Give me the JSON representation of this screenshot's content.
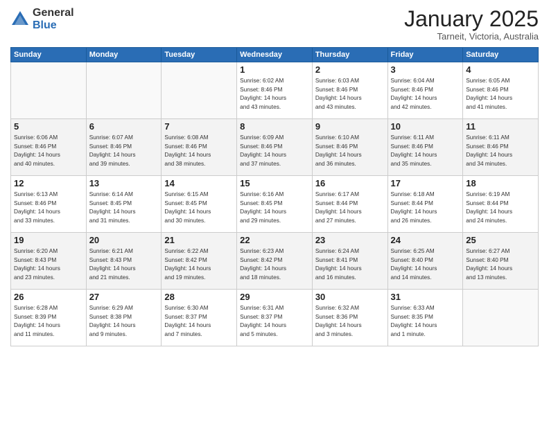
{
  "logo": {
    "general": "General",
    "blue": "Blue"
  },
  "header": {
    "month": "January 2025",
    "location": "Tarneit, Victoria, Australia"
  },
  "weekdays": [
    "Sunday",
    "Monday",
    "Tuesday",
    "Wednesday",
    "Thursday",
    "Friday",
    "Saturday"
  ],
  "weeks": [
    [
      {
        "day": "",
        "info": ""
      },
      {
        "day": "",
        "info": ""
      },
      {
        "day": "",
        "info": ""
      },
      {
        "day": "1",
        "info": "Sunrise: 6:02 AM\nSunset: 8:46 PM\nDaylight: 14 hours\nand 43 minutes."
      },
      {
        "day": "2",
        "info": "Sunrise: 6:03 AM\nSunset: 8:46 PM\nDaylight: 14 hours\nand 43 minutes."
      },
      {
        "day": "3",
        "info": "Sunrise: 6:04 AM\nSunset: 8:46 PM\nDaylight: 14 hours\nand 42 minutes."
      },
      {
        "day": "4",
        "info": "Sunrise: 6:05 AM\nSunset: 8:46 PM\nDaylight: 14 hours\nand 41 minutes."
      }
    ],
    [
      {
        "day": "5",
        "info": "Sunrise: 6:06 AM\nSunset: 8:46 PM\nDaylight: 14 hours\nand 40 minutes."
      },
      {
        "day": "6",
        "info": "Sunrise: 6:07 AM\nSunset: 8:46 PM\nDaylight: 14 hours\nand 39 minutes."
      },
      {
        "day": "7",
        "info": "Sunrise: 6:08 AM\nSunset: 8:46 PM\nDaylight: 14 hours\nand 38 minutes."
      },
      {
        "day": "8",
        "info": "Sunrise: 6:09 AM\nSunset: 8:46 PM\nDaylight: 14 hours\nand 37 minutes."
      },
      {
        "day": "9",
        "info": "Sunrise: 6:10 AM\nSunset: 8:46 PM\nDaylight: 14 hours\nand 36 minutes."
      },
      {
        "day": "10",
        "info": "Sunrise: 6:11 AM\nSunset: 8:46 PM\nDaylight: 14 hours\nand 35 minutes."
      },
      {
        "day": "11",
        "info": "Sunrise: 6:11 AM\nSunset: 8:46 PM\nDaylight: 14 hours\nand 34 minutes."
      }
    ],
    [
      {
        "day": "12",
        "info": "Sunrise: 6:13 AM\nSunset: 8:46 PM\nDaylight: 14 hours\nand 33 minutes."
      },
      {
        "day": "13",
        "info": "Sunrise: 6:14 AM\nSunset: 8:45 PM\nDaylight: 14 hours\nand 31 minutes."
      },
      {
        "day": "14",
        "info": "Sunrise: 6:15 AM\nSunset: 8:45 PM\nDaylight: 14 hours\nand 30 minutes."
      },
      {
        "day": "15",
        "info": "Sunrise: 6:16 AM\nSunset: 8:45 PM\nDaylight: 14 hours\nand 29 minutes."
      },
      {
        "day": "16",
        "info": "Sunrise: 6:17 AM\nSunset: 8:44 PM\nDaylight: 14 hours\nand 27 minutes."
      },
      {
        "day": "17",
        "info": "Sunrise: 6:18 AM\nSunset: 8:44 PM\nDaylight: 14 hours\nand 26 minutes."
      },
      {
        "day": "18",
        "info": "Sunrise: 6:19 AM\nSunset: 8:44 PM\nDaylight: 14 hours\nand 24 minutes."
      }
    ],
    [
      {
        "day": "19",
        "info": "Sunrise: 6:20 AM\nSunset: 8:43 PM\nDaylight: 14 hours\nand 23 minutes."
      },
      {
        "day": "20",
        "info": "Sunrise: 6:21 AM\nSunset: 8:43 PM\nDaylight: 14 hours\nand 21 minutes."
      },
      {
        "day": "21",
        "info": "Sunrise: 6:22 AM\nSunset: 8:42 PM\nDaylight: 14 hours\nand 19 minutes."
      },
      {
        "day": "22",
        "info": "Sunrise: 6:23 AM\nSunset: 8:42 PM\nDaylight: 14 hours\nand 18 minutes."
      },
      {
        "day": "23",
        "info": "Sunrise: 6:24 AM\nSunset: 8:41 PM\nDaylight: 14 hours\nand 16 minutes."
      },
      {
        "day": "24",
        "info": "Sunrise: 6:25 AM\nSunset: 8:40 PM\nDaylight: 14 hours\nand 14 minutes."
      },
      {
        "day": "25",
        "info": "Sunrise: 6:27 AM\nSunset: 8:40 PM\nDaylight: 14 hours\nand 13 minutes."
      }
    ],
    [
      {
        "day": "26",
        "info": "Sunrise: 6:28 AM\nSunset: 8:39 PM\nDaylight: 14 hours\nand 11 minutes."
      },
      {
        "day": "27",
        "info": "Sunrise: 6:29 AM\nSunset: 8:38 PM\nDaylight: 14 hours\nand 9 minutes."
      },
      {
        "day": "28",
        "info": "Sunrise: 6:30 AM\nSunset: 8:37 PM\nDaylight: 14 hours\nand 7 minutes."
      },
      {
        "day": "29",
        "info": "Sunrise: 6:31 AM\nSunset: 8:37 PM\nDaylight: 14 hours\nand 5 minutes."
      },
      {
        "day": "30",
        "info": "Sunrise: 6:32 AM\nSunset: 8:36 PM\nDaylight: 14 hours\nand 3 minutes."
      },
      {
        "day": "31",
        "info": "Sunrise: 6:33 AM\nSunset: 8:35 PM\nDaylight: 14 hours\nand 1 minute."
      },
      {
        "day": "",
        "info": ""
      }
    ]
  ]
}
